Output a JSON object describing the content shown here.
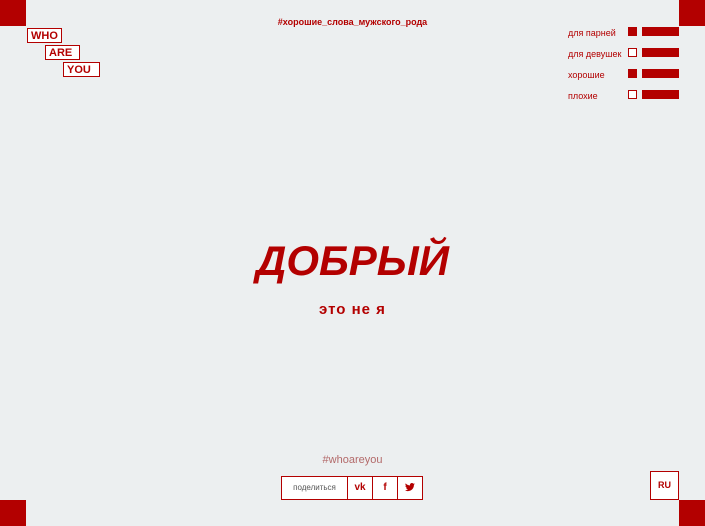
{
  "logo": {
    "word1": "WHO",
    "word2": "ARE",
    "word3": "YOU"
  },
  "hashtag_top": "#хорошие_слова_мужского_рода",
  "filters": [
    {
      "label": "для парней",
      "checked": true
    },
    {
      "label": "для девушек",
      "checked": false
    },
    {
      "label": "хорошие",
      "checked": true
    },
    {
      "label": "плохие",
      "checked": false
    }
  ],
  "main": {
    "word": "ДОБРЫЙ",
    "subtitle": "это не я"
  },
  "footer": {
    "hashtag": "#whoareyou",
    "share_label": "поделиться",
    "share_vk": "vk",
    "share_facebook": "f",
    "share_twitter": "t",
    "lang": "RU"
  },
  "colors": {
    "accent": "#b30000",
    "background": "#eceff0"
  }
}
